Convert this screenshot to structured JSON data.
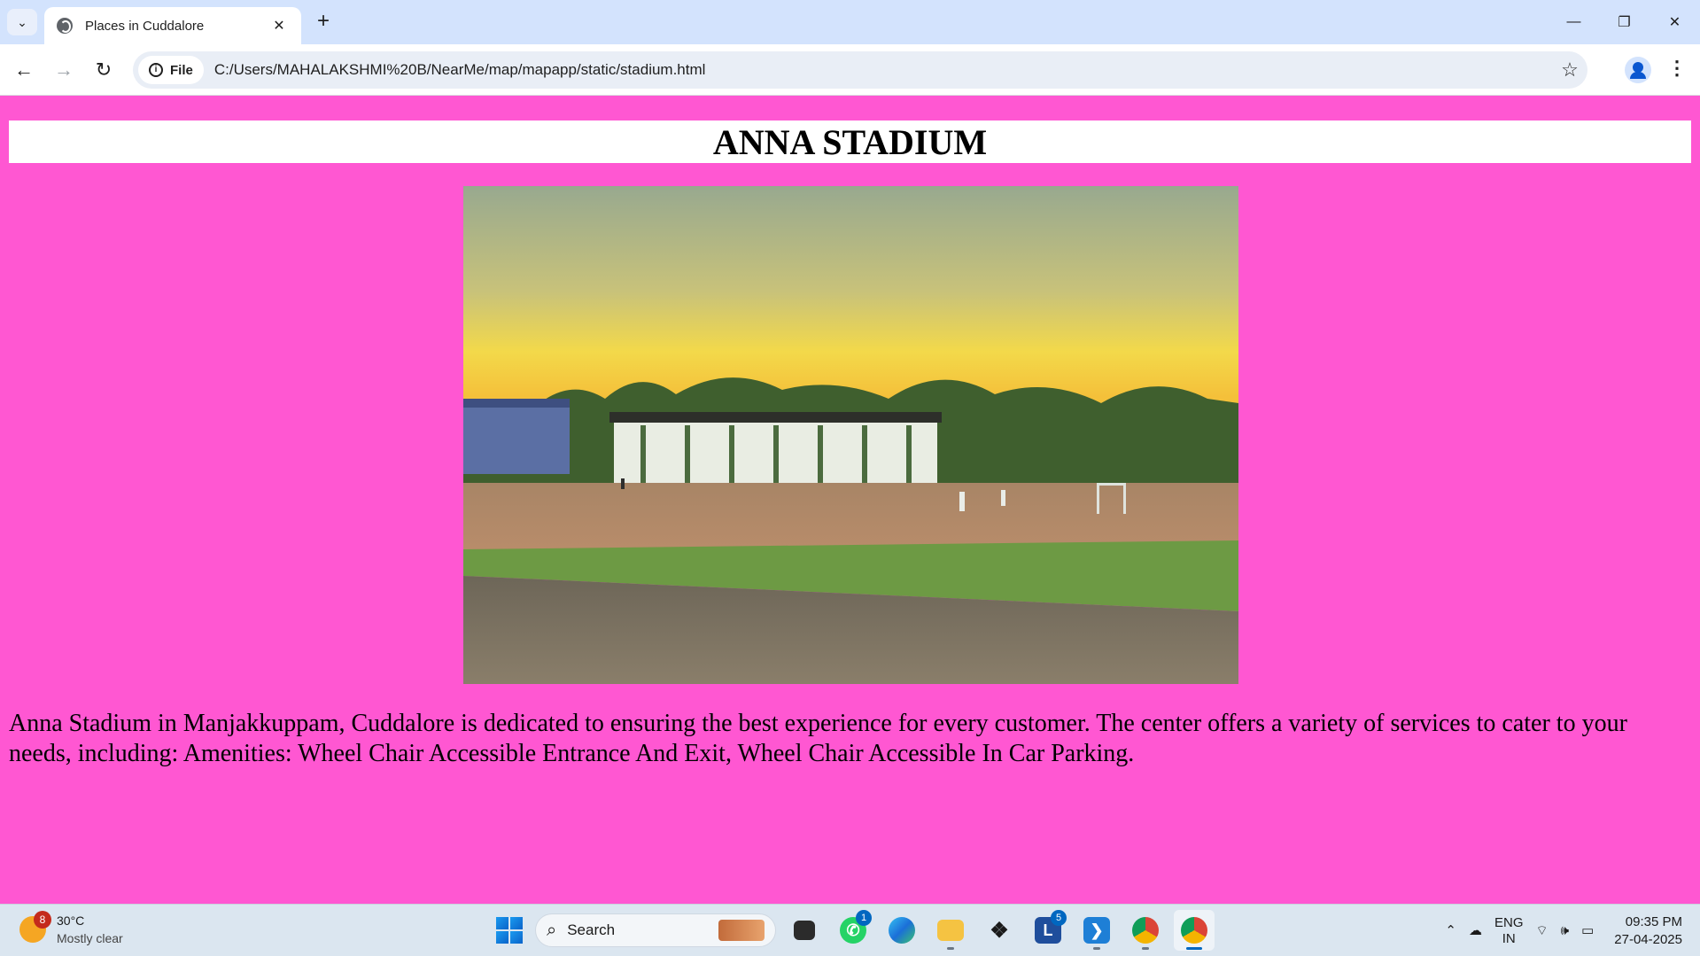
{
  "browser": {
    "tab_title": "Places in Cuddalore",
    "chip_label": "File",
    "url": "C:/Users/MAHALAKSHMI%20B/NearMe/map/mapapp/static/stadium.html"
  },
  "page": {
    "heading": "ANNA STADIUM",
    "background_color": "#ff57d2",
    "description": "Anna Stadium in Manjakkuppam, Cuddalore is dedicated to ensuring the best experience for every customer. The center offers a variety of services to cater to your needs, including: Amenities: Wheel Chair Accessible Entrance And Exit, Wheel Chair Accessible In Car Parking."
  },
  "taskbar": {
    "weather_temp": "30°C",
    "weather_desc": "Mostly clear",
    "weather_badge": "8",
    "search_label": "Search",
    "whatsapp_badge": "1",
    "lapp_badge": "5",
    "lang_line1": "ENG",
    "lang_line2": "IN",
    "time": "09:35 PM",
    "date": "27-04-2025"
  }
}
